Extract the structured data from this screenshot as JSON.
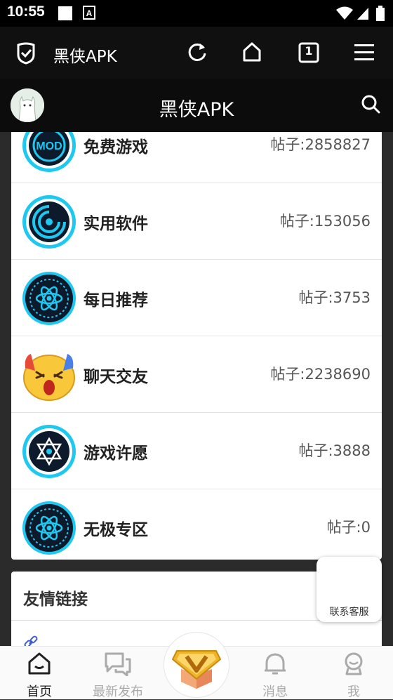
{
  "status_bar": {
    "time": "10:55"
  },
  "browser": {
    "title": "黑侠APK",
    "tab_count": "1"
  },
  "header": {
    "title": "黑侠APK"
  },
  "forums": [
    {
      "name": "免费游戏",
      "count": "帖子:2858827",
      "icon": "mod-icon"
    },
    {
      "name": "实用软件",
      "count": "帖子:153056",
      "icon": "swirl-icon"
    },
    {
      "name": "每日推荐",
      "count": "帖子:3753",
      "icon": "atom-icon"
    },
    {
      "name": "聊天交友",
      "count": "帖子:2238690",
      "icon": "emoji-icon"
    },
    {
      "name": "游戏许愿",
      "count": "帖子:3888",
      "icon": "hexagram-icon"
    },
    {
      "name": "无极专区",
      "count": "帖子:0",
      "icon": "atom-icon"
    }
  ],
  "links": {
    "title": "友情链接"
  },
  "float_button": {
    "label": "联系客服"
  },
  "nav": {
    "home": "首页",
    "latest": "最新发布",
    "messages": "消息",
    "me": "我"
  },
  "colors": {
    "accent_cyan": "#1fc8f0",
    "icon_dark": "#0d1a2b",
    "emoji_yellow": "#f8c73a",
    "badge_gold": "#f0b429",
    "badge_orange": "#e87a3c"
  }
}
